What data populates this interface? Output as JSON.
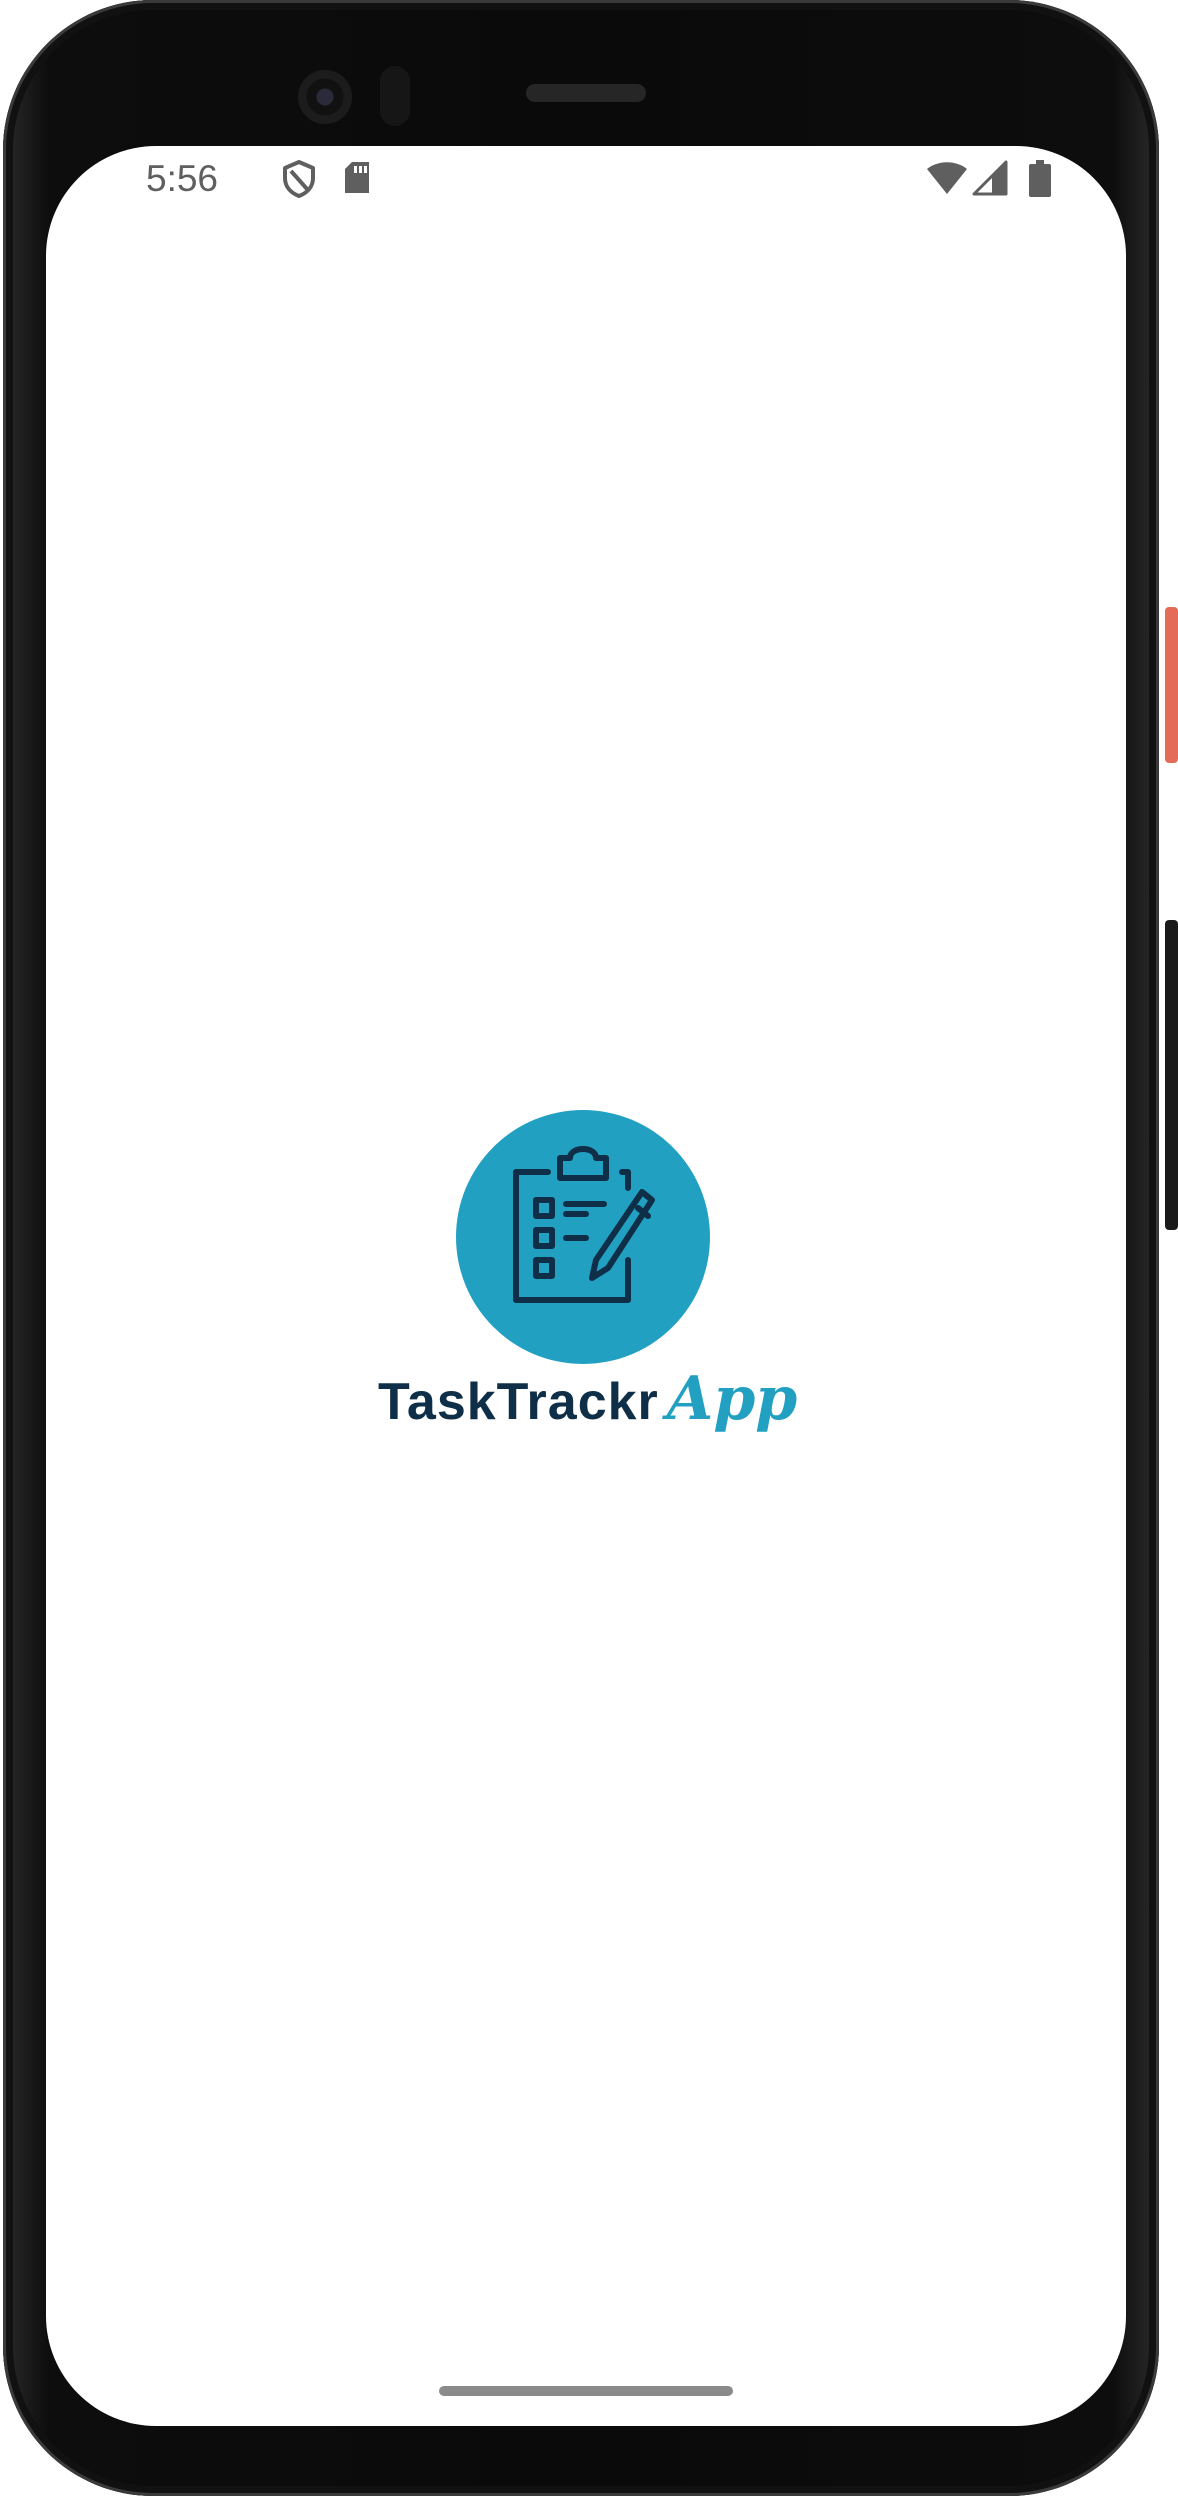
{
  "status_bar": {
    "time": "5:56",
    "left_icons": [
      "shield-icon",
      "sd-card-icon"
    ],
    "right_icons": [
      "wifi-icon",
      "cellular-signal-icon",
      "battery-icon"
    ]
  },
  "splash": {
    "logo_icon": "clipboard-checklist-pencil-icon",
    "brand_main": "TaskTrackr",
    "brand_accent": "App"
  },
  "colors": {
    "logo_circle": "#22A0C2",
    "brand_main": "#0E2F47",
    "brand_accent": "#22A0C2",
    "status_icons": "#5f5f5f",
    "home_indicator": "#8a8a8a",
    "screen_background": "#FFFFFF"
  }
}
